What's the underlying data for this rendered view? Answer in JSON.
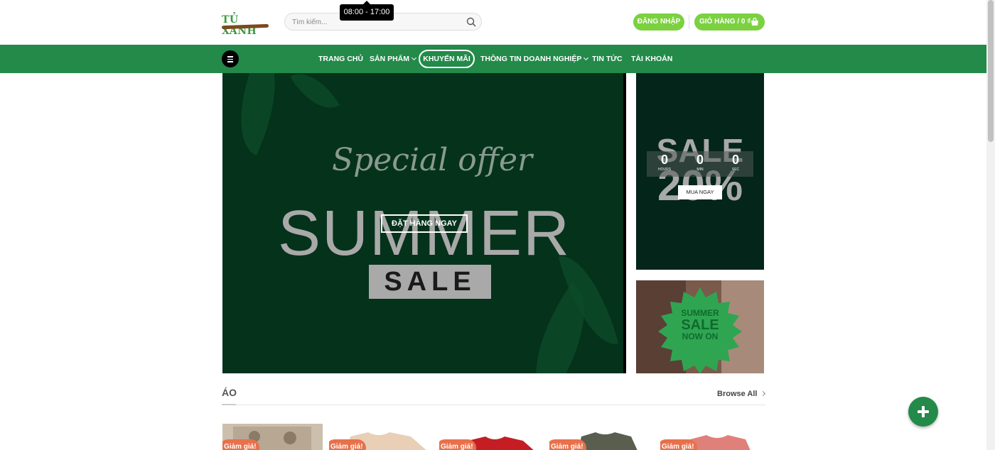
{
  "header": {
    "logo_text": "TỦ XANH",
    "search_placeholder": "Tìm kiếm...",
    "tooltip": "08:00 - 17:00",
    "login_label": "ĐĂNG NHẬP",
    "cart_label": "GIỎ HÀNG / 0 ₫"
  },
  "nav": {
    "items": [
      "TRANG CHỦ",
      "SẢN PHẨM",
      "KHUYẾN MÃI",
      "THÔNG TIN DOANH NGHIỆP",
      "TIN TỨC",
      "TÀI KHOẢN"
    ],
    "active": "KHUYẾN MÃI"
  },
  "banner_main": {
    "script_text": "Special offer",
    "headline": "SUMMER",
    "sale_text": "SALE",
    "button_label": "ĐẶT HÀNG NGAY"
  },
  "banner_side": {
    "sale_text": "SALE",
    "percent_text": "20%",
    "countdown": [
      {
        "value": "0",
        "label": "HOURS"
      },
      {
        "value": "0",
        "label": "MIN"
      },
      {
        "value": "0",
        "label": "SEC"
      }
    ],
    "button_label": "MUA NGAY"
  },
  "banner_side2": {
    "line1": "SUMMER",
    "line2": "SALE",
    "line3": "NOW ON"
  },
  "section": {
    "title": "ÁO",
    "browse_label": "Browse All"
  },
  "products": [
    {
      "badge": "Giảm giá!"
    },
    {
      "badge": "Giảm giá!"
    },
    {
      "badge": "Giảm giá!"
    },
    {
      "badge": "Giảm giá!"
    },
    {
      "badge": "Giảm giá!"
    }
  ],
  "colors": {
    "brand_green": "#238a4a",
    "button_green": "#7bd13f",
    "badge_orange": "#e8704a"
  }
}
